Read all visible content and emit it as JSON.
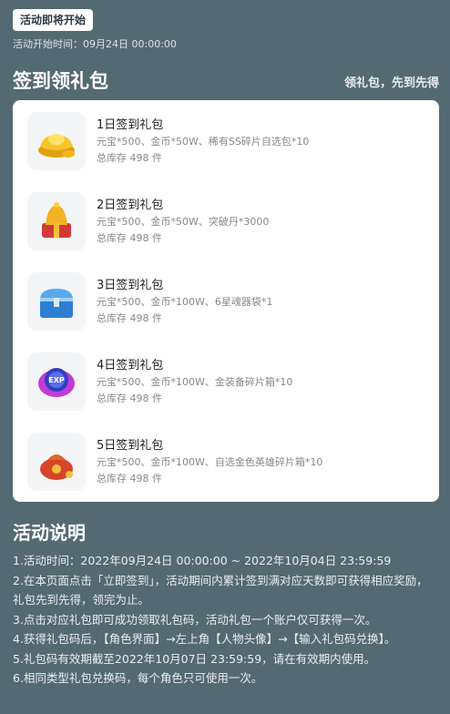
{
  "header": {
    "badge": "活动即将开始",
    "start_time": "活动开始时间：09月24日 00:00:00"
  },
  "signin": {
    "title": "签到领礼包",
    "subtitle": "领礼包，先到先得",
    "items": [
      {
        "name": "1日签到礼包",
        "desc": "元宝*500、金币*50W、稀有SS碎片自选包*10",
        "stock": "总库存 498 件",
        "icon": "gold-ingot-icon"
      },
      {
        "name": "2日签到礼包",
        "desc": "元宝*500、金币*50W、突破丹*3000",
        "stock": "总库存 498 件",
        "icon": "bell-gift-icon"
      },
      {
        "name": "3日签到礼包",
        "desc": "元宝*500、金币*100W、6星魂器袋*1",
        "stock": "总库存 498 件",
        "icon": "treasure-chest-icon"
      },
      {
        "name": "4日签到礼包",
        "desc": "元宝*500、金币*100W、金装备碎片箱*10",
        "stock": "总库存 498 件",
        "icon": "exp-orb-icon"
      },
      {
        "name": "5日签到礼包",
        "desc": "元宝*500、金币*100W、自选金色英雄碎片箱*10",
        "stock": "总库存 498 件",
        "icon": "lucky-bag-icon"
      }
    ]
  },
  "rules": {
    "title": "活动说明",
    "lines": [
      "1.活动时间：2022年09月24日 00:00:00 ~ 2022年10月04日 23:59:59",
      "2.在本页面点击「立即签到」，活动期间内累计签到满对应天数即可获得相应奖励，礼包先到先得，领完为止。",
      "3.点击对应礼包即可成功领取礼包码，活动礼包一个账户仅可获得一次。",
      "4.获得礼包码后，【角色界面】→左上角【人物头像】→【输入礼包码兑换】。",
      "5.礼包码有效期截至2022年10月07日 23:59:59，请在有效期内使用。",
      "6.相同类型礼包兑换码，每个角色只可使用一次。"
    ]
  }
}
